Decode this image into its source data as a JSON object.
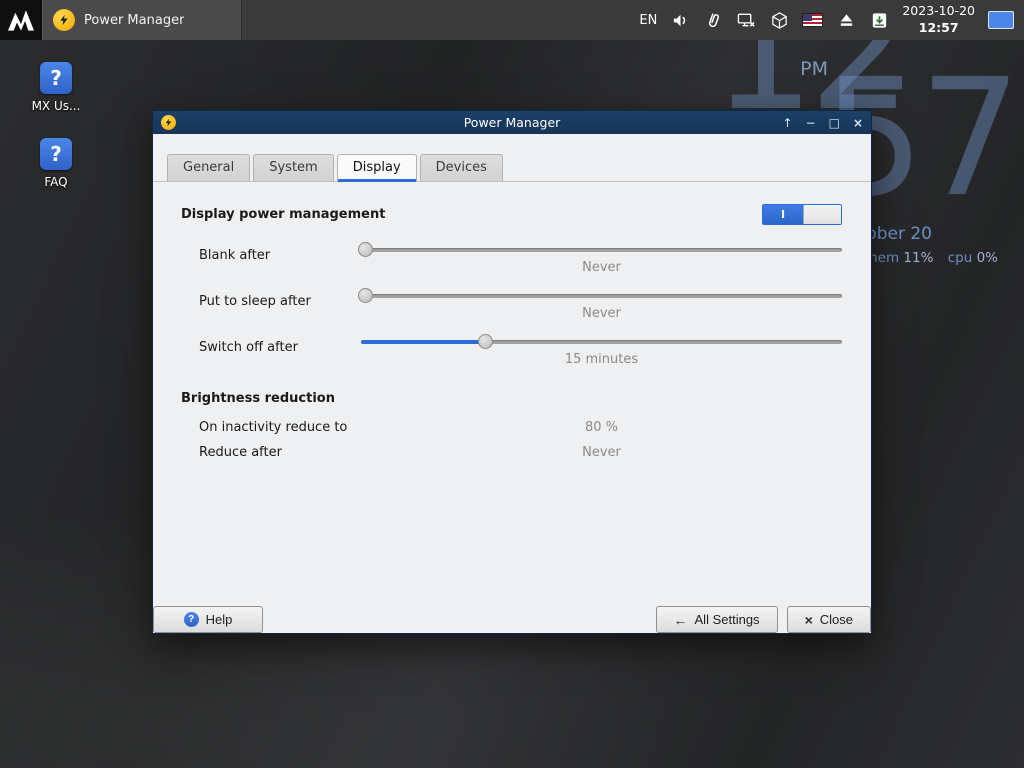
{
  "colors": {
    "accent": "#2a6dd9",
    "titlebar": "#16365c"
  },
  "panel": {
    "task_label": "Power Manager",
    "lang": "EN",
    "date": "2023-10-20",
    "time": "12:57"
  },
  "desktop": {
    "icons": [
      {
        "label": "MX Us..."
      },
      {
        "label": "FAQ"
      }
    ],
    "clock": {
      "hour": "12",
      "minute": "57",
      "ampm": "PM",
      "date": "October 20"
    },
    "stats": {
      "mem_label": "mem",
      "mem_value": "11%",
      "cpu_label": "cpu",
      "cpu_value": "0%"
    }
  },
  "window": {
    "title": "Power Manager",
    "controls": {
      "shade": "↑",
      "minimize": "−",
      "maximize": "□",
      "close": "×"
    },
    "tabs": [
      {
        "label": "General"
      },
      {
        "label": "System"
      },
      {
        "label": "Display"
      },
      {
        "label": "Devices"
      }
    ],
    "active_tab": "Display",
    "content": {
      "section_display": "Display power management",
      "switch_on_label": "I",
      "sliders": [
        {
          "label": "Blank after",
          "value": "Never",
          "percent": 1
        },
        {
          "label": "Put to sleep after",
          "value": "Never",
          "percent": 1
        },
        {
          "label": "Switch off after",
          "value": "15 minutes",
          "percent": 26
        }
      ],
      "section_brightness": "Brightness reduction",
      "fields": [
        {
          "label": "On inactivity reduce to",
          "value": "80 %"
        },
        {
          "label": "Reduce after",
          "value": "Never"
        }
      ]
    },
    "footer": {
      "help": "Help",
      "all_settings": "All Settings",
      "close": "Close"
    }
  }
}
